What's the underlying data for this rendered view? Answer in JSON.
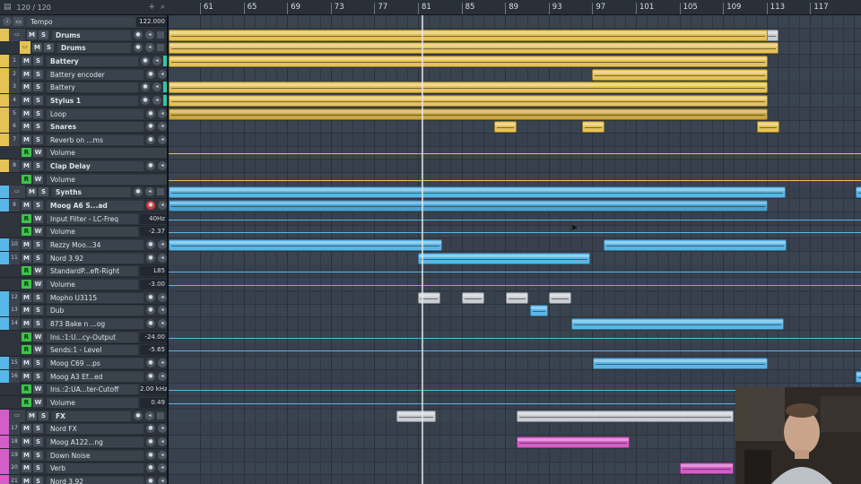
{
  "header": {
    "track_count": "120 / 120"
  },
  "ruler": {
    "bars": [
      "61",
      "65",
      "69",
      "73",
      "77",
      "81",
      "85",
      "89",
      "93",
      "97",
      "101",
      "105",
      "109",
      "113",
      "117"
    ]
  },
  "tracks": [
    {
      "num": "",
      "name": "Tempo",
      "value": "122.000",
      "type": "tempo"
    },
    {
      "num": "",
      "name": "Drums",
      "type": "folder",
      "color": "#e6c256",
      "bold": true
    },
    {
      "num": "",
      "name": "Drums",
      "type": "group",
      "color": "#e6c256",
      "bold": true
    },
    {
      "num": "1",
      "name": "Battery",
      "type": "midi",
      "color": "#e6c256",
      "bold": true
    },
    {
      "num": "2",
      "name": "Battery encoder",
      "type": "midi",
      "color": "#e6c256"
    },
    {
      "num": "3",
      "name": "Battery",
      "type": "midi",
      "color": "#e6c256"
    },
    {
      "num": "4",
      "name": "Stylus 1",
      "type": "midi",
      "color": "#e6c256",
      "bold": true
    },
    {
      "num": "5",
      "name": "Loop",
      "type": "audio",
      "color": "#e6c256"
    },
    {
      "num": "6",
      "name": "Snares",
      "type": "audio",
      "color": "#e6c256",
      "bold": true
    },
    {
      "num": "7",
      "name": "Reverb on ...ms",
      "type": "audio",
      "color": "#e6c256"
    },
    {
      "num": "",
      "name": "Volume",
      "type": "automation",
      "color": "#e6c256"
    },
    {
      "num": "8",
      "name": "Clap Delay",
      "type": "audio",
      "color": "#e6c256",
      "bold": true
    },
    {
      "num": "",
      "name": "Volume",
      "type": "automation",
      "color": "#e6c256"
    },
    {
      "num": "",
      "name": "Synths",
      "type": "folder",
      "color": "#59b6e8",
      "bold": true
    },
    {
      "num": "9",
      "name": "Moog A6 S...ad",
      "type": "instrument",
      "color": "#59b6e8",
      "bold": true,
      "rec": true
    },
    {
      "num": "",
      "name": "Input Filter - LC-Freq",
      "value": "40Hz",
      "type": "automation",
      "color": "#59b6e8"
    },
    {
      "num": "",
      "name": "Volume",
      "value": "-2.37",
      "type": "automation",
      "color": "#59b6e8"
    },
    {
      "num": "10",
      "name": "Rezzy Moo...34",
      "type": "instrument",
      "color": "#59b6e8"
    },
    {
      "num": "11",
      "name": "Nord 3.92",
      "type": "instrument",
      "color": "#59b6e8"
    },
    {
      "num": "",
      "name": "StandardP...eft-Right",
      "value": "L85",
      "type": "automation",
      "color": "#59b6e8"
    },
    {
      "num": "",
      "name": "Volume",
      "value": "-3.00",
      "type": "automation",
      "color": "#59b6e8"
    },
    {
      "num": "12",
      "name": "Mopho U3115",
      "type": "instrument",
      "color": "#59b6e8"
    },
    {
      "num": "13",
      "name": "Dub",
      "type": "instrument",
      "color": "#59b6e8"
    },
    {
      "num": "14",
      "name": "873 Bake n ...og",
      "type": "instrument",
      "color": "#59b6e8"
    },
    {
      "num": "",
      "name": "Ins.:1:U...cy-Output",
      "value": "-24.00",
      "type": "automation",
      "color": "#59b6e8"
    },
    {
      "num": "",
      "name": "Sends:1 - Level",
      "value": "-5.65",
      "type": "automation",
      "color": "#59b6e8"
    },
    {
      "num": "15",
      "name": "Moog C69 ...ps",
      "type": "instrument",
      "color": "#59b6e8"
    },
    {
      "num": "16",
      "name": "Moog A3 Ef...ed",
      "type": "instrument",
      "color": "#59b6e8"
    },
    {
      "num": "",
      "name": "Ins.:2:UA...ter-Cutoff",
      "value": "2.00 kHz",
      "type": "automation",
      "color": "#59b6e8"
    },
    {
      "num": "",
      "name": "Volume",
      "value": "0.49",
      "type": "automation",
      "color": "#59b6e8"
    },
    {
      "num": "",
      "name": "FX",
      "type": "folder",
      "color": "#d45ec8",
      "bold": true
    },
    {
      "num": "17",
      "name": "Nord FX",
      "type": "instrument",
      "color": "#d45ec8"
    },
    {
      "num": "18",
      "name": "Moog A122...ng",
      "type": "instrument",
      "color": "#d45ec8"
    },
    {
      "num": "19",
      "name": "Down Noise",
      "type": "instrument",
      "color": "#d45ec8"
    },
    {
      "num": "20",
      "name": "Verb",
      "type": "instrument",
      "color": "#d45ec8"
    },
    {
      "num": "21",
      "name": "Nord 3.92",
      "type": "instrument",
      "color": "#d45ec8"
    }
  ],
  "colors": {
    "drums": "#e6c256",
    "synths": "#59b6e8",
    "fx": "#d45ec8"
  },
  "icons": [
    "track-list-icon",
    "folder-icon",
    "add-track-icon",
    "search-icon",
    "metronome-icon",
    "mute-icon",
    "solo-icon",
    "read-icon",
    "write-icon",
    "record-icon",
    "monitor-icon",
    "mouse-cursor-icon"
  ]
}
